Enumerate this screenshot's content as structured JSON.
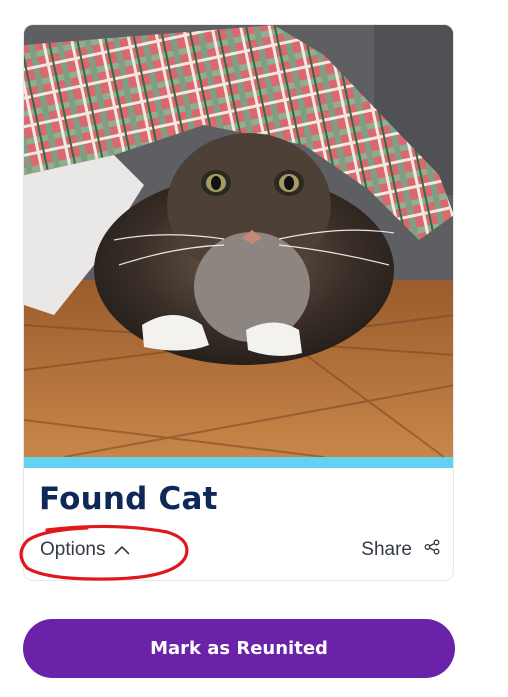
{
  "listing": {
    "title": "Found Cat",
    "options_label": "Options",
    "share_label": "Share",
    "photo_subject": "cat-under-plaid-paper"
  },
  "actions": {
    "reunite_label": "Mark as Reunited"
  },
  "icons": {
    "options": "chevron-up-icon",
    "share": "share-icon"
  },
  "colors": {
    "title": "#0f2859",
    "accent_bar": "#63d2f2",
    "primary_button": "#6a22a8",
    "annotation": "#e0181e"
  }
}
